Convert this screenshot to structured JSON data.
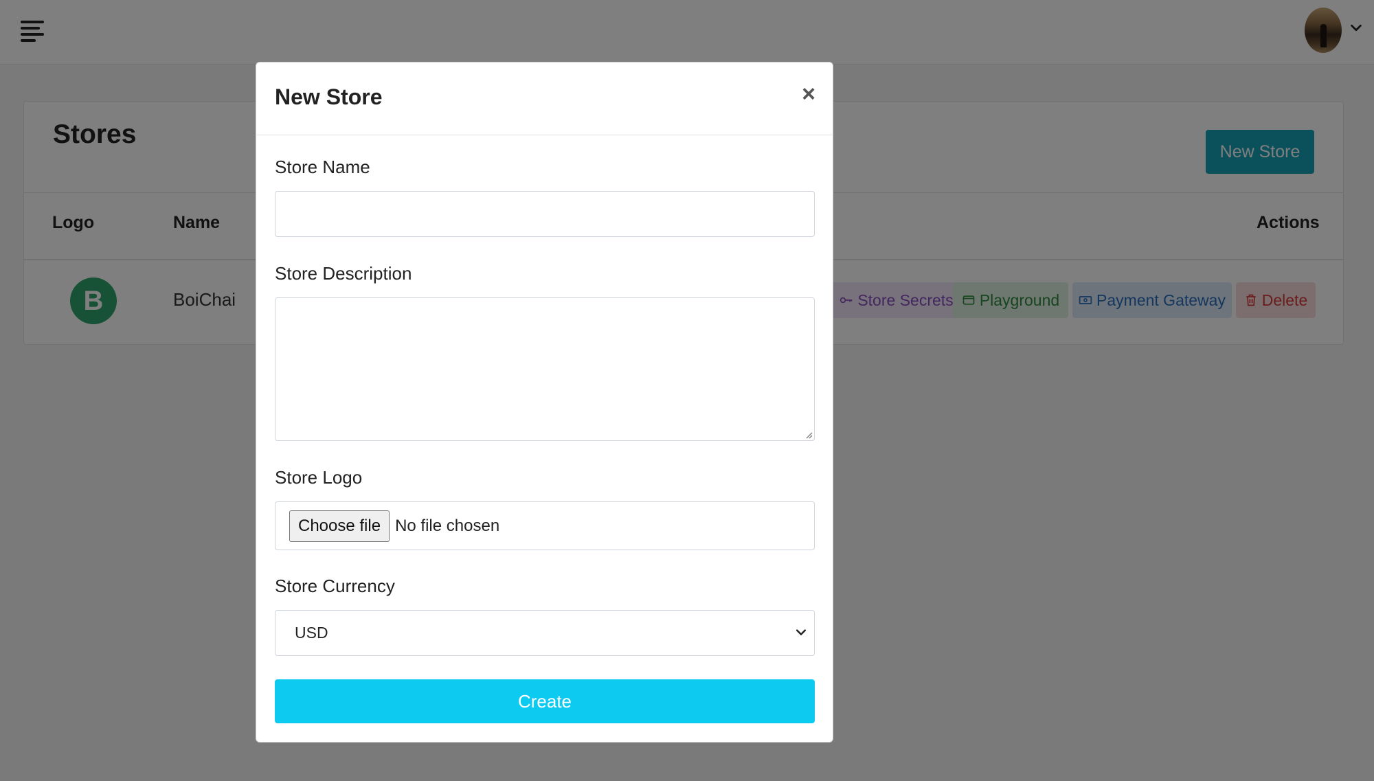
{
  "header": {
    "menu_icon": "hamburger-icon",
    "avatar_icon": "user-avatar",
    "dropdown_icon": "chevron-down-icon"
  },
  "stores_card": {
    "title": "Stores",
    "new_store_label": "New Store",
    "columns": [
      "Logo",
      "Name",
      "Actions"
    ],
    "rows": [
      {
        "logo_letter": "B",
        "name": "BoiChai",
        "actions": [
          "Store Secrets",
          "Playground",
          "Payment Gateway",
          "Delete"
        ]
      }
    ]
  },
  "modal": {
    "title": "New Store",
    "close_symbol": "×",
    "fields": {
      "name_label": "Store Name",
      "name_value": "",
      "description_label": "Store Description",
      "description_value": "",
      "logo_label": "Store Logo",
      "file_button_label": "Choose file",
      "file_status": "No file chosen",
      "currency_label": "Store Currency",
      "currency_value": "USD"
    },
    "submit_label": "Create"
  },
  "colors": {
    "accent_info": "#17a2b8",
    "create_button": "#0dcaf0",
    "store_logo": "#2ea36c",
    "backdrop": "rgba(0,0,0,0.5)"
  }
}
